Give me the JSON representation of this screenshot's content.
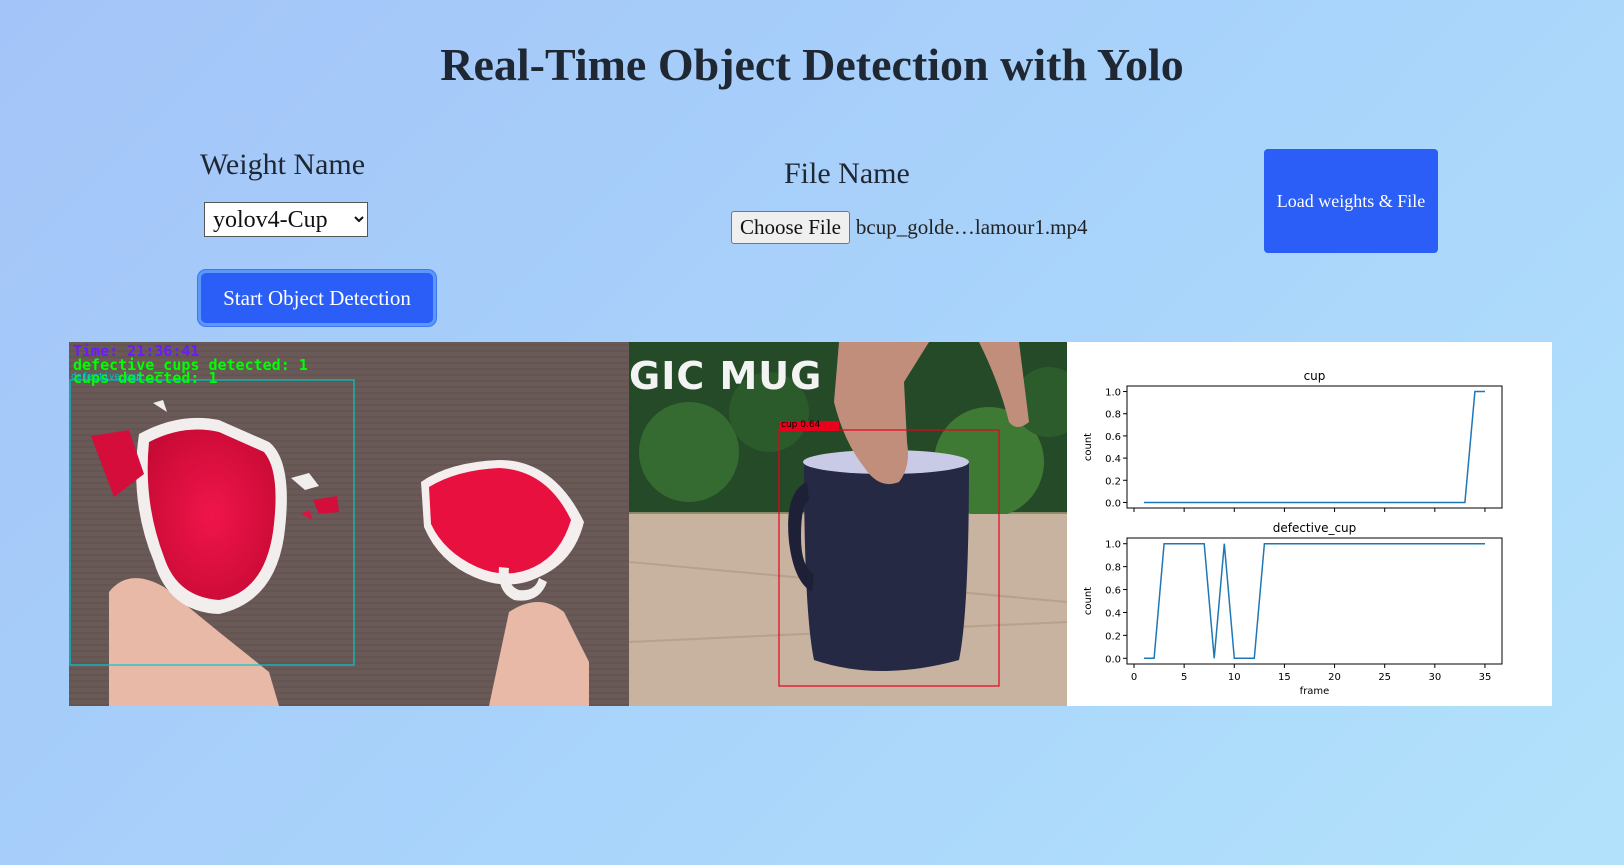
{
  "page": {
    "title": "Real-Time Object Detection with Yolo"
  },
  "weights": {
    "label": "Weight Name",
    "selected": "yolov4-Cup"
  },
  "file": {
    "label": "File Name",
    "button_label": "Choose File",
    "selected_name": "bcup_golde…lamour1.mp4"
  },
  "actions": {
    "load_label": "Load weights & File",
    "start_label": "Start Object Detection"
  },
  "colors": {
    "accent": "#2a5ef6",
    "overlay_time": "#6a1bff",
    "overlay_defective": "#00ff00",
    "box_cyan": "#00c8c8",
    "box_red": "#e8001c",
    "plot_line": "#1f77b4"
  },
  "stream_left": {
    "time_text": "Time: 21:36:41",
    "defective_text": "defective_cups detected: 1",
    "cups_text": "cups detected: 1",
    "box_label": "defective_cup"
  },
  "stream_mid": {
    "banner_text": "GIC MUG",
    "box_label": "cup 0.64"
  },
  "chart_data": [
    {
      "type": "line",
      "title": "cup",
      "ylabel": "count",
      "xlabel": "",
      "x": [
        1,
        2,
        3,
        4,
        5,
        6,
        7,
        8,
        9,
        10,
        11,
        12,
        13,
        14,
        15,
        16,
        17,
        18,
        19,
        20,
        21,
        22,
        23,
        24,
        25,
        26,
        27,
        28,
        29,
        30,
        31,
        32,
        33,
        34,
        35
      ],
      "values": [
        0,
        0,
        0,
        0,
        0,
        0,
        0,
        0,
        0,
        0,
        0,
        0,
        0,
        0,
        0,
        0,
        0,
        0,
        0,
        0,
        0,
        0,
        0,
        0,
        0,
        0,
        0,
        0,
        0,
        0,
        0,
        0,
        0,
        1,
        1
      ],
      "xlim": [
        -0.7,
        36.7
      ],
      "ylim": [
        -0.05,
        1.05
      ],
      "yticks": [
        "0.0",
        "0.2",
        "0.4",
        "0.6",
        "0.8",
        "1.0"
      ],
      "xticks": []
    },
    {
      "type": "line",
      "title": "defective_cup",
      "ylabel": "count",
      "xlabel": "frame",
      "x": [
        1,
        2,
        3,
        4,
        5,
        6,
        7,
        8,
        9,
        10,
        11,
        12,
        13,
        14,
        15,
        16,
        17,
        18,
        19,
        20,
        21,
        22,
        23,
        24,
        25,
        26,
        27,
        28,
        29,
        30,
        31,
        32,
        33,
        34,
        35
      ],
      "values": [
        0,
        0,
        1,
        1,
        1,
        1,
        1,
        0,
        1,
        0,
        0,
        0,
        1,
        1,
        1,
        1,
        1,
        1,
        1,
        1,
        1,
        1,
        1,
        1,
        1,
        1,
        1,
        1,
        1,
        1,
        1,
        1,
        1,
        1,
        1
      ],
      "xlim": [
        -0.7,
        36.7
      ],
      "ylim": [
        -0.05,
        1.05
      ],
      "yticks": [
        "0.0",
        "0.2",
        "0.4",
        "0.6",
        "0.8",
        "1.0"
      ],
      "xticks": [
        "0",
        "5",
        "10",
        "15",
        "20",
        "25",
        "30",
        "35"
      ]
    }
  ]
}
